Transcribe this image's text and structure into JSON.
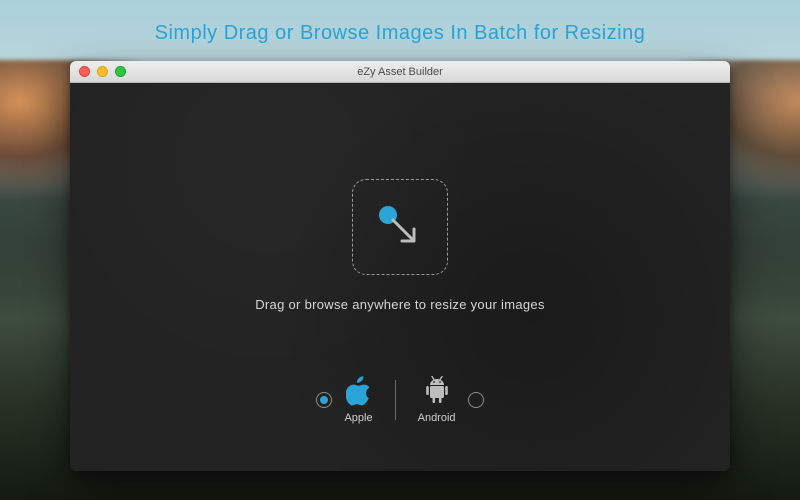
{
  "headline": "Simply Drag or Browse Images In  Batch for Resizing",
  "window": {
    "title": "eZy Asset Builder"
  },
  "dropzone": {
    "hint": "Drag or browse anywhere to resize your images"
  },
  "platforms": {
    "apple": {
      "label": "Apple",
      "selected": true
    },
    "android": {
      "label": "Android",
      "selected": false
    }
  },
  "colors": {
    "accent": "#2aa3d6"
  }
}
